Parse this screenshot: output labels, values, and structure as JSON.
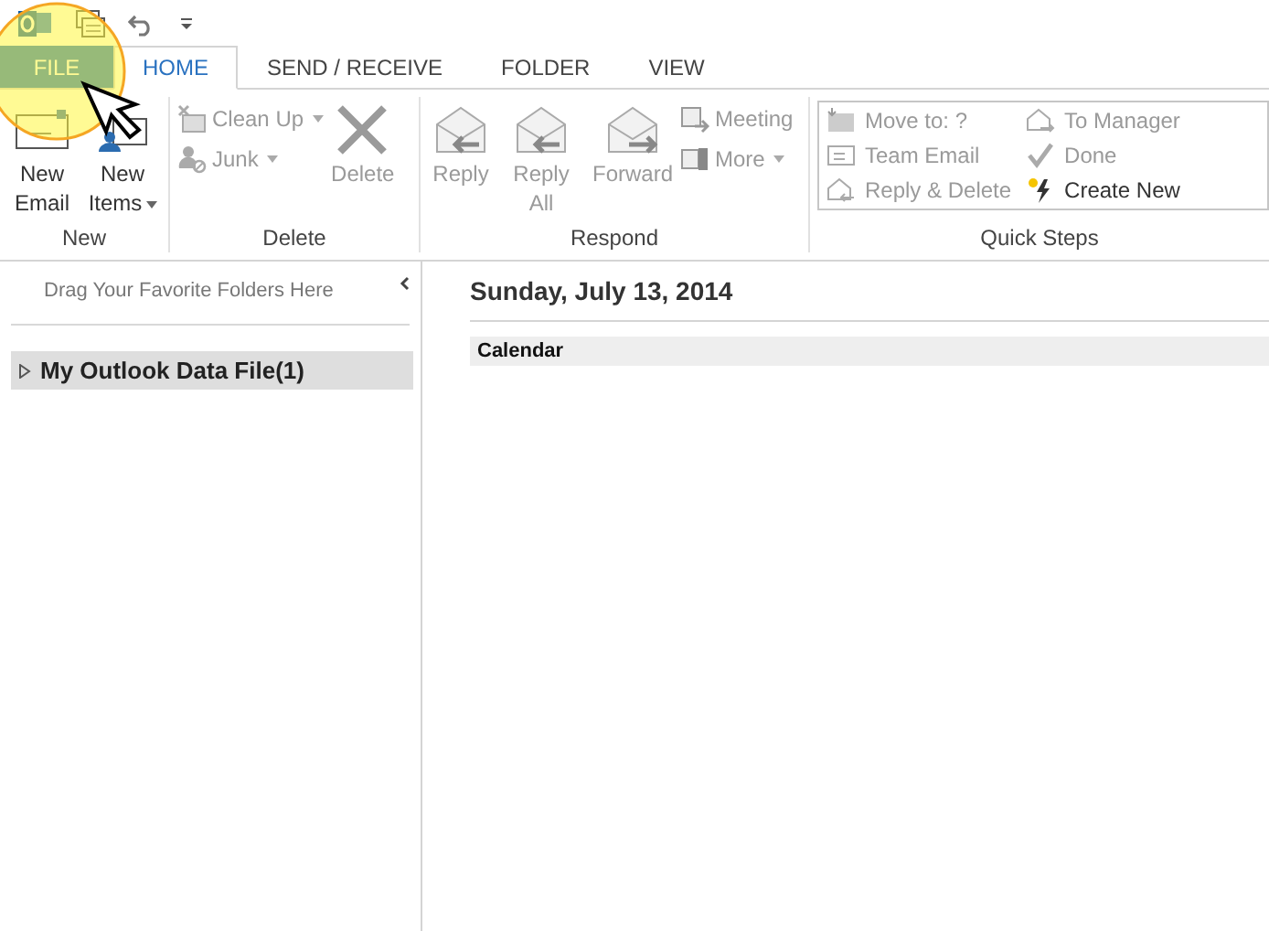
{
  "tabs": [
    {
      "label": "FILE",
      "kind": "backstage",
      "selected": false
    },
    {
      "label": "HOME",
      "kind": "tab",
      "selected": true
    },
    {
      "label": "SEND / RECEIVE",
      "kind": "tab",
      "selected": false
    },
    {
      "label": "FOLDER",
      "kind": "tab",
      "selected": false
    },
    {
      "label": "VIEW",
      "kind": "tab",
      "selected": false
    }
  ],
  "ribbon": {
    "groups": [
      {
        "label": "New",
        "items": [
          {
            "label": "New Email",
            "kind": "large",
            "disabled": false,
            "dropdown": false
          },
          {
            "label": "New Items",
            "kind": "large",
            "disabled": false,
            "dropdown": true
          }
        ]
      },
      {
        "label": "Delete",
        "items": [
          {
            "label": "Clean Up",
            "kind": "small",
            "disabled": true,
            "dropdown": true
          },
          {
            "label": "Junk",
            "kind": "small",
            "disabled": true,
            "dropdown": true
          },
          {
            "label": "Delete",
            "kind": "large",
            "disabled": true,
            "dropdown": false
          }
        ]
      },
      {
        "label": "Respond",
        "items": [
          {
            "label": "Reply",
            "kind": "large",
            "disabled": true,
            "dropdown": false
          },
          {
            "label": "Reply All",
            "kind": "large",
            "disabled": true,
            "dropdown": false
          },
          {
            "label": "Forward",
            "kind": "large",
            "disabled": true,
            "dropdown": false
          },
          {
            "label": "Meeting",
            "kind": "small",
            "disabled": true,
            "dropdown": false
          },
          {
            "label": "More",
            "kind": "small",
            "disabled": true,
            "dropdown": true
          }
        ]
      },
      {
        "label": "Quick Steps",
        "items": [
          {
            "label": "Move to: ?",
            "kind": "quickstep",
            "disabled": true
          },
          {
            "label": "Team Email",
            "kind": "quickstep",
            "disabled": true
          },
          {
            "label": "Reply & Delete",
            "kind": "quickstep",
            "disabled": true
          },
          {
            "label": "To Manager",
            "kind": "quickstep",
            "disabled": true
          },
          {
            "label": "Done",
            "kind": "quickstep",
            "disabled": true
          },
          {
            "label": "Create New",
            "kind": "quickstep",
            "disabled": false
          }
        ]
      }
    ]
  },
  "folder_pane": {
    "favorites_hint": "Drag Your Favorite Folders Here",
    "folders": [
      {
        "label": "My Outlook Data File(1)",
        "expanded": false,
        "selected": true
      }
    ]
  },
  "main": {
    "date": "Sunday, July 13, 2014",
    "section": "Calendar"
  }
}
